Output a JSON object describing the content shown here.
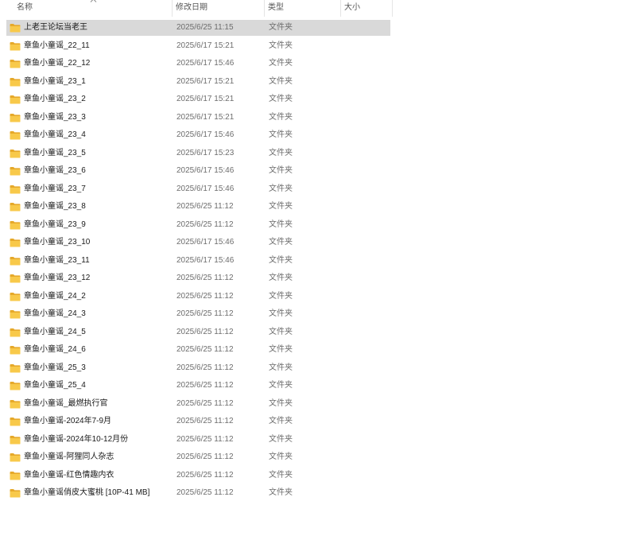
{
  "columns": {
    "name": "名称",
    "date": "修改日期",
    "type": "类型",
    "size": "大小"
  },
  "files": [
    {
      "name": "上老王论坛当老王",
      "date": "2025/6/25 11:15",
      "type": "文件夹",
      "selected": true
    },
    {
      "name": "章鱼小童谣_22_11",
      "date": "2025/6/17 15:21",
      "type": "文件夹"
    },
    {
      "name": "章鱼小童谣_22_12",
      "date": "2025/6/17 15:46",
      "type": "文件夹"
    },
    {
      "name": "章鱼小童谣_23_1",
      "date": "2025/6/17 15:21",
      "type": "文件夹"
    },
    {
      "name": "章鱼小童谣_23_2",
      "date": "2025/6/17 15:21",
      "type": "文件夹"
    },
    {
      "name": "章鱼小童谣_23_3",
      "date": "2025/6/17 15:21",
      "type": "文件夹"
    },
    {
      "name": "章鱼小童谣_23_4",
      "date": "2025/6/17 15:46",
      "type": "文件夹"
    },
    {
      "name": "章鱼小童谣_23_5",
      "date": "2025/6/17 15:23",
      "type": "文件夹"
    },
    {
      "name": "章鱼小童谣_23_6",
      "date": "2025/6/17 15:46",
      "type": "文件夹"
    },
    {
      "name": "章鱼小童谣_23_7",
      "date": "2025/6/17 15:46",
      "type": "文件夹"
    },
    {
      "name": "章鱼小童谣_23_8",
      "date": "2025/6/25 11:12",
      "type": "文件夹"
    },
    {
      "name": "章鱼小童谣_23_9",
      "date": "2025/6/25 11:12",
      "type": "文件夹"
    },
    {
      "name": "章鱼小童谣_23_10",
      "date": "2025/6/17 15:46",
      "type": "文件夹"
    },
    {
      "name": "章鱼小童谣_23_11",
      "date": "2025/6/17 15:46",
      "type": "文件夹"
    },
    {
      "name": "章鱼小童谣_23_12",
      "date": "2025/6/25 11:12",
      "type": "文件夹"
    },
    {
      "name": "章鱼小童谣_24_2",
      "date": "2025/6/25 11:12",
      "type": "文件夹"
    },
    {
      "name": "章鱼小童谣_24_3",
      "date": "2025/6/25 11:12",
      "type": "文件夹"
    },
    {
      "name": "章鱼小童谣_24_5",
      "date": "2025/6/25 11:12",
      "type": "文件夹"
    },
    {
      "name": "章鱼小童谣_24_6",
      "date": "2025/6/25 11:12",
      "type": "文件夹"
    },
    {
      "name": "章鱼小童谣_25_3",
      "date": "2025/6/25 11:12",
      "type": "文件夹"
    },
    {
      "name": "章鱼小童谣_25_4",
      "date": "2025/6/25 11:12",
      "type": "文件夹"
    },
    {
      "name": "章鱼小童谣_最燃执行官",
      "date": "2025/6/25 11:12",
      "type": "文件夹"
    },
    {
      "name": "章鱼小童谣-2024年7-9月",
      "date": "2025/6/25 11:12",
      "type": "文件夹"
    },
    {
      "name": "章鱼小童谣-2024年10-12月份",
      "date": "2025/6/25 11:12",
      "type": "文件夹"
    },
    {
      "name": "章鱼小童谣-阿狸同人杂志",
      "date": "2025/6/25 11:12",
      "type": "文件夹"
    },
    {
      "name": "章鱼小童谣-红色情趣内衣",
      "date": "2025/6/25 11:12",
      "type": "文件夹"
    },
    {
      "name": "章鱼小童谣俏皮大蜜桃 [10P-41 MB]",
      "date": "2025/6/25 11:12",
      "type": "文件夹"
    }
  ],
  "icons": {
    "folder": "folder-icon",
    "sort": "sort-up-icon"
  },
  "colors": {
    "selected_row": "#d9d9d9",
    "folder_body": "#f8c94a",
    "folder_tab": "#e6a92a",
    "meta_text": "#6d6d6d"
  }
}
